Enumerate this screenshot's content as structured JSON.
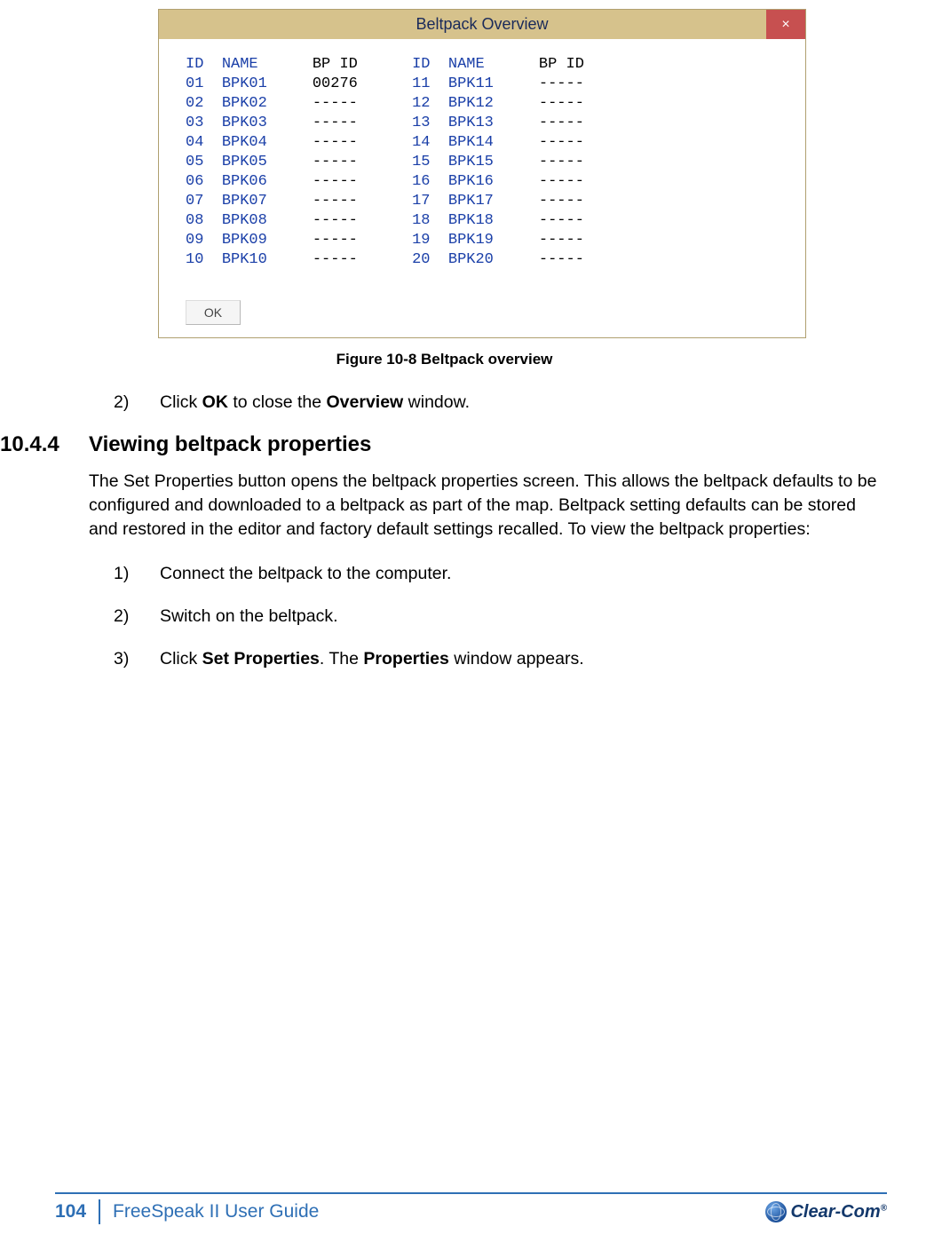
{
  "dialog": {
    "title": "Beltpack Overview",
    "close": "×",
    "ok": "OK",
    "headers": {
      "id": "ID",
      "name": "NAME",
      "bpid": "BP ID"
    },
    "left": [
      {
        "id": "01",
        "name": "BPK01",
        "bpid": "00276"
      },
      {
        "id": "02",
        "name": "BPK02",
        "bpid": "-----"
      },
      {
        "id": "03",
        "name": "BPK03",
        "bpid": "-----"
      },
      {
        "id": "04",
        "name": "BPK04",
        "bpid": "-----"
      },
      {
        "id": "05",
        "name": "BPK05",
        "bpid": "-----"
      },
      {
        "id": "06",
        "name": "BPK06",
        "bpid": "-----"
      },
      {
        "id": "07",
        "name": "BPK07",
        "bpid": "-----"
      },
      {
        "id": "08",
        "name": "BPK08",
        "bpid": "-----"
      },
      {
        "id": "09",
        "name": "BPK09",
        "bpid": "-----"
      },
      {
        "id": "10",
        "name": "BPK10",
        "bpid": "-----"
      }
    ],
    "right": [
      {
        "id": "11",
        "name": "BPK11",
        "bpid": "-----"
      },
      {
        "id": "12",
        "name": "BPK12",
        "bpid": "-----"
      },
      {
        "id": "13",
        "name": "BPK13",
        "bpid": "-----"
      },
      {
        "id": "14",
        "name": "BPK14",
        "bpid": "-----"
      },
      {
        "id": "15",
        "name": "BPK15",
        "bpid": "-----"
      },
      {
        "id": "16",
        "name": "BPK16",
        "bpid": "-----"
      },
      {
        "id": "17",
        "name": "BPK17",
        "bpid": "-----"
      },
      {
        "id": "18",
        "name": "BPK18",
        "bpid": "-----"
      },
      {
        "id": "19",
        "name": "BPK19",
        "bpid": "-----"
      },
      {
        "id": "20",
        "name": "BPK20",
        "bpid": "-----"
      }
    ]
  },
  "figure_caption": "Figure 10-8 Beltpack overview",
  "pre_step": {
    "num": "2)",
    "pre": "Click ",
    "b1": "OK",
    "mid": " to close the ",
    "b2": "Overview",
    "post": " window."
  },
  "section": {
    "num": "10.4.4",
    "title": "Viewing beltpack properties"
  },
  "paragraph": "The Set Properties button opens the beltpack properties screen. This allows the beltpack defaults to be configured and downloaded to a beltpack as part of the map. Beltpack setting defaults can be stored and restored in the editor and factory default settings recalled. To view the beltpack properties:",
  "steps": [
    {
      "num": "1)",
      "text": "Connect the beltpack to the computer."
    },
    {
      "num": "2)",
      "text": "Switch on the beltpack."
    }
  ],
  "step3": {
    "num": "3)",
    "pre": "Click ",
    "b1": "Set Properties",
    "mid": ". The ",
    "b2": "Properties",
    "post": " window appears."
  },
  "footer": {
    "page": "104",
    "guide": "FreeSpeak II User Guide",
    "brand": "Clear-Com",
    "reg": "®"
  }
}
